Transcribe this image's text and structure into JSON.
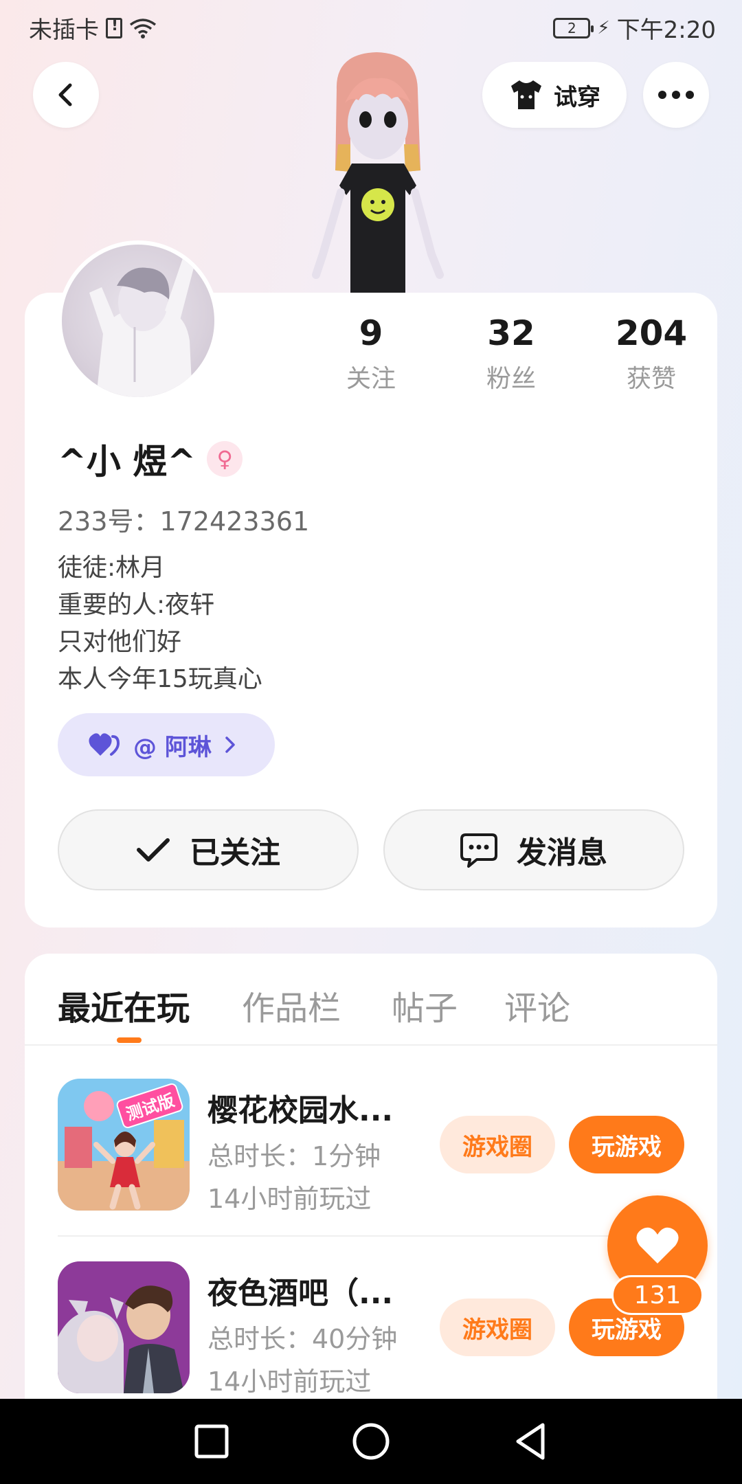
{
  "status_bar": {
    "carrier": "未插卡",
    "battery": "2",
    "time": "下午2:20"
  },
  "header": {
    "tryon_label": "试穿"
  },
  "profile": {
    "stats": [
      {
        "value": "9",
        "label": "关注"
      },
      {
        "value": "32",
        "label": "粉丝"
      },
      {
        "value": "204",
        "label": "获赞"
      }
    ],
    "nickname": "^小 煜^",
    "uid_label": "233号：",
    "uid_value": "172423361",
    "bio": [
      "徒徒:林月",
      "重要的人:夜轩",
      "只对他们好",
      "本人今年15玩真心"
    ],
    "bond_tag": "@ 阿琳",
    "follow_label": "已关注",
    "message_label": "发消息"
  },
  "tabs": [
    "最近在玩",
    "作品栏",
    "帖子",
    "评论"
  ],
  "games": [
    {
      "title": "樱花校园水...",
      "duration": "总时长：1分钟",
      "last_played": "14小时前玩过",
      "badge": "测试版",
      "circle_label": "游戏圈",
      "play_label": "玩游戏"
    },
    {
      "title": "夜色酒吧（...",
      "duration": "总时长：40分钟",
      "last_played": "14小时前玩过",
      "circle_label": "游戏圈",
      "play_label": "玩游戏"
    }
  ],
  "like_count": "131",
  "colors": {
    "accent": "#ff7a1a",
    "accent_light": "#ffe9dc",
    "bond_bg": "#e8e6fb",
    "bond_text": "#5d54d8"
  }
}
